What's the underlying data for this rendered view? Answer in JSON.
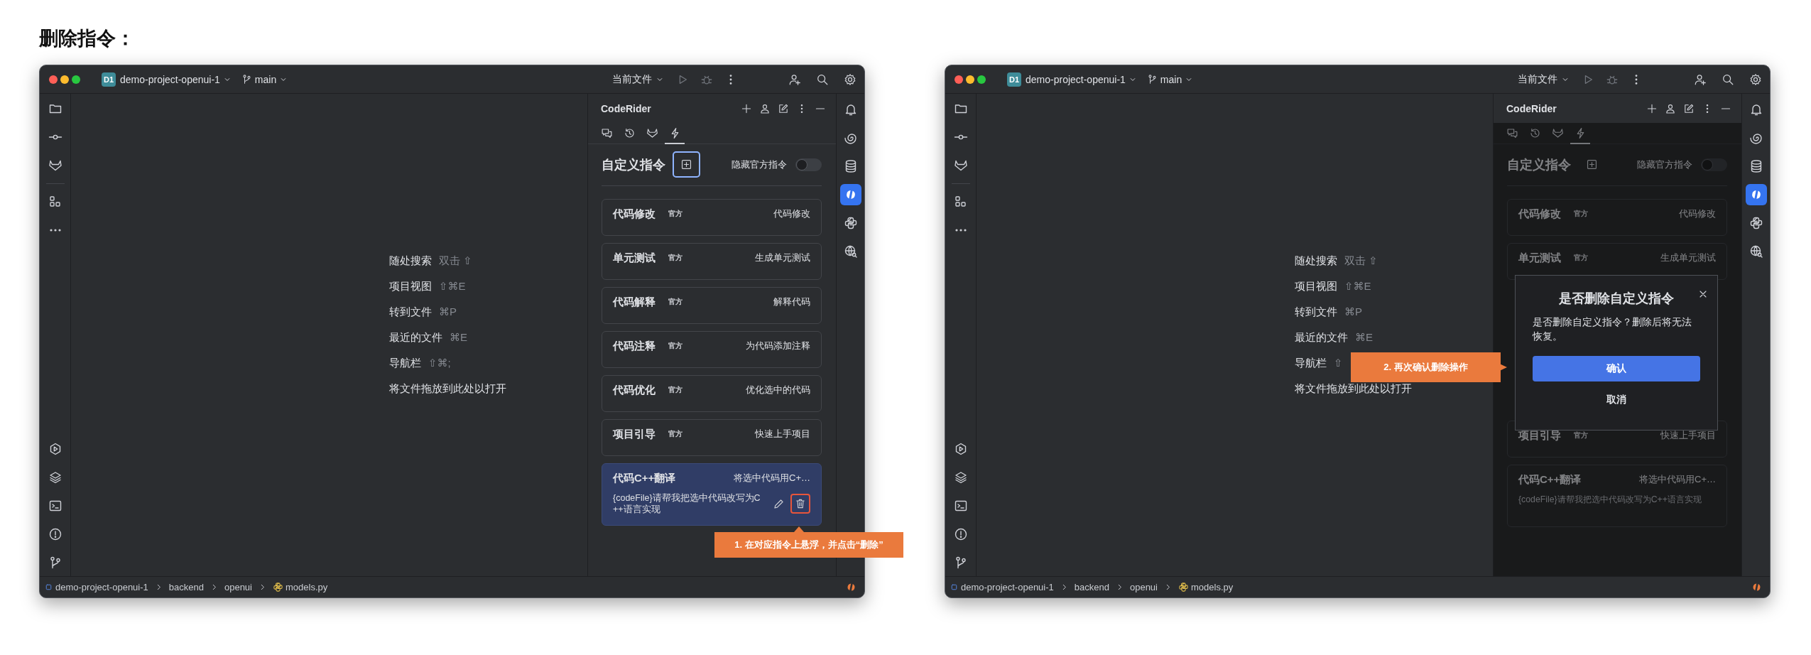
{
  "heading": "删除指令：",
  "windows": [
    {
      "project": {
        "badge": "D1",
        "name": "demo-project-openui-1"
      },
      "branch": "main",
      "run_config": "当前文件",
      "hints": [
        {
          "action": "随处搜索",
          "shortcut": "双击 ⇧"
        },
        {
          "action": "项目视图",
          "shortcut": "⇧⌘E"
        },
        {
          "action": "转到文件",
          "shortcut": "⌘P"
        },
        {
          "action": "最近的文件",
          "shortcut": "⌘E"
        },
        {
          "action": "导航栏",
          "shortcut": "⇧⌘;"
        },
        {
          "action": "将文件拖放到此处以打开"
        }
      ],
      "tool_windows": [
        {
          "kind": "bell",
          "selected": false
        },
        {
          "kind": "spiral",
          "selected": false
        },
        {
          "kind": "database",
          "selected": false
        },
        {
          "kind": "codeslash",
          "selected": true
        },
        {
          "kind": "python",
          "selected": false
        },
        {
          "kind": "globe",
          "selected": false
        }
      ],
      "panel": {
        "title": "CodeRider",
        "tabs": [
          {
            "kind": "chat",
            "selected": false
          },
          {
            "kind": "history",
            "selected": false
          },
          {
            "kind": "fox",
            "selected": false
          },
          {
            "kind": "bolt",
            "selected": true
          }
        ],
        "section_title": "自定义指令",
        "add_button": {
          "highlighted": true
        },
        "toggle": {
          "label": "隐藏官方指令",
          "on": false
        },
        "commands": [
          {
            "name": "代码修改",
            "badge": "官方",
            "description": "代码修改",
            "hovered": false
          },
          {
            "name": "单元测试",
            "badge": "官方",
            "description": "生成单元测试",
            "hovered": false
          },
          {
            "name": "代码解释",
            "badge": "官方",
            "description": "解释代码",
            "hovered": false
          },
          {
            "name": "代码注释",
            "badge": "官方",
            "description": "为代码添加注释",
            "hovered": false
          },
          {
            "name": "代码优化",
            "badge": "官方",
            "description": "优化选中的代码",
            "hovered": false
          },
          {
            "name": "项目引导",
            "badge": "官方",
            "description": "快速上手项目",
            "hovered": false
          },
          {
            "name": "代码C++翻译",
            "description": "将选中代码用C+…",
            "prompt": "{codeFile}请帮我把选中代码改写为C++语言实现",
            "hovered": true,
            "delete_highlighted": true
          }
        ]
      },
      "callout": {
        "text": "1. 在对应指令上悬浮，并点击“删除”",
        "kind": "up"
      },
      "breadcrumb": [
        {
          "text": "demo-project-openui-1",
          "kind": "project"
        },
        {
          "text": "backend",
          "kind": "folder"
        },
        {
          "text": "openui",
          "kind": "folder"
        },
        {
          "text": "models.py",
          "kind": "python"
        }
      ]
    },
    {
      "project": {
        "badge": "D1",
        "name": "demo-project-openui-1"
      },
      "branch": "main",
      "run_config": "当前文件",
      "hints": [
        {
          "action": "随处搜索",
          "shortcut": "双击 ⇧"
        },
        {
          "action": "项目视图",
          "shortcut": "⇧⌘E"
        },
        {
          "action": "转到文件",
          "shortcut": "⌘P"
        },
        {
          "action": "最近的文件",
          "shortcut": "⌘E"
        },
        {
          "action": "导航栏",
          "shortcut": "⇧"
        },
        {
          "action": "将文件拖放到此处以打开"
        }
      ],
      "tool_windows": [
        {
          "kind": "bell",
          "selected": false
        },
        {
          "kind": "spiral",
          "selected": false
        },
        {
          "kind": "database",
          "selected": false
        },
        {
          "kind": "codeslash",
          "selected": true
        },
        {
          "kind": "python",
          "selected": false
        },
        {
          "kind": "globe",
          "selected": false
        }
      ],
      "panel": {
        "title": "CodeRider",
        "dimmed": true,
        "tabs": [
          {
            "kind": "chat",
            "selected": false
          },
          {
            "kind": "history",
            "selected": false
          },
          {
            "kind": "fox",
            "selected": false
          },
          {
            "kind": "bolt",
            "selected": true
          }
        ],
        "section_title": "自定义指令",
        "add_button": {
          "highlighted": false
        },
        "toggle": {
          "label": "隐藏官方指令",
          "on": false
        },
        "commands": [
          {
            "name": "代码修改",
            "badge": "官方",
            "description": "代码修改",
            "hovered": false
          },
          {
            "name": "单元测试",
            "badge": "官方",
            "description": "生成单元测试",
            "hovered": false
          },
          {
            "name": "项目引导",
            "badge": "官方",
            "description": "快速上手项目",
            "hovered": false
          },
          {
            "name": "代码C++翻译",
            "description": "将选中代码用C+…",
            "prompt": "{codeFile}请帮我把选中代码改写为C++语言实现",
            "hovered": false
          }
        ],
        "dialog": {
          "title": "是否删除自定义指令",
          "message": "是否删除自定义指令？删除后将无法恢复。",
          "confirm": "确认",
          "cancel": "取消"
        }
      },
      "callout": {
        "text": "2. 再次确认删除操作",
        "kind": "right"
      },
      "breadcrumb": [
        {
          "text": "demo-project-openui-1",
          "kind": "project"
        },
        {
          "text": "backend",
          "kind": "folder"
        },
        {
          "text": "openui",
          "kind": "folder"
        },
        {
          "text": "models.py",
          "kind": "python"
        }
      ]
    }
  ]
}
